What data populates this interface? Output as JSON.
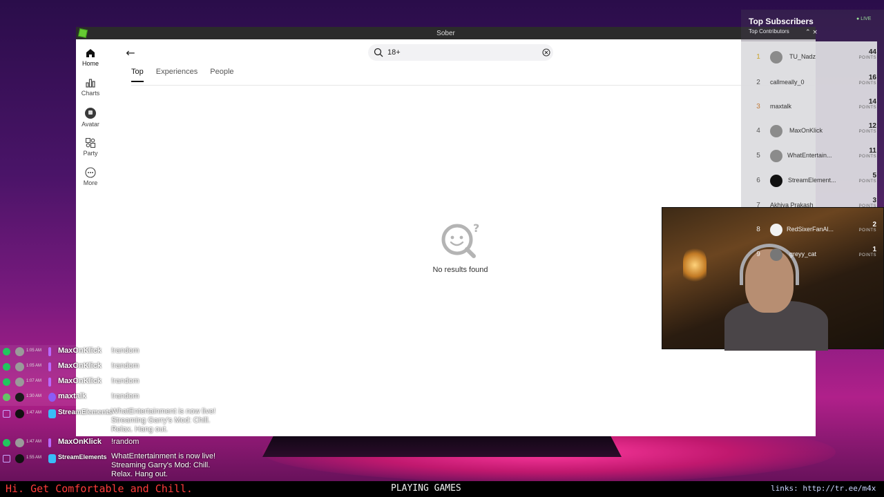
{
  "window": {
    "title": "Sober"
  },
  "sidebar": {
    "items": [
      {
        "label": "Home",
        "icon": "home-icon",
        "active": true
      },
      {
        "label": "Charts",
        "icon": "charts-icon"
      },
      {
        "label": "Avatar",
        "icon": "avatar-icon"
      },
      {
        "label": "Party",
        "icon": "party-icon"
      },
      {
        "label": "More",
        "icon": "more-icon"
      }
    ]
  },
  "search": {
    "value": "18+"
  },
  "tabs": [
    {
      "label": "Top",
      "active": true
    },
    {
      "label": "Experiences"
    },
    {
      "label": "People"
    }
  ],
  "empty_state": {
    "message": "No results found"
  },
  "leaderboard": {
    "title": "Top Subscribers",
    "subtitle": "Top Contributors",
    "live": "LIVE",
    "points_label": "POINTS",
    "rows": [
      {
        "rank": "1",
        "name": "TU_Nadz",
        "points": "44"
      },
      {
        "rank": "2",
        "name": "callmeally_0",
        "points": "16"
      },
      {
        "rank": "3",
        "name": "maxtalk",
        "points": "14"
      },
      {
        "rank": "4",
        "name": "MaxOnKlick",
        "points": "12"
      },
      {
        "rank": "5",
        "name": "WhatEntertain...",
        "points": "11"
      },
      {
        "rank": "6",
        "name": "StreamElement...",
        "points": "5"
      },
      {
        "rank": "7",
        "name": "Akhiya Prakash",
        "points": "3"
      },
      {
        "rank": "8",
        "name": "RedSixerFanAl...",
        "points": "2"
      },
      {
        "rank": "9",
        "name": "greyy_cat",
        "points": "1"
      }
    ]
  },
  "chat": [
    {
      "time": "1:05 AM",
      "user": "MaxOnKlick",
      "message": "!random"
    },
    {
      "time": "1:05 AM",
      "user": "MaxOnKlick",
      "message": "!random"
    },
    {
      "time": "1:07 AM",
      "user": "MaxOnKlick",
      "message": "!random"
    },
    {
      "time": "1:30 AM",
      "user": "maxtalk",
      "message": "!random"
    },
    {
      "time": "1:47 AM",
      "user": "StreamElements",
      "message": "WhatEntertainment is now live! Streaming Garry's Mod: Chill. Relax. Hang out."
    },
    {
      "time": "1:47 AM",
      "user": "MaxOnKlick",
      "message": "!random"
    },
    {
      "time": "1:55 AM",
      "user": "StreamElements",
      "message": "WhatEntertainment is now live! Streaming Garry's Mod: Chill. Relax. Hang out."
    }
  ],
  "ticker": {
    "left": "Hi. Get Comfortable and Chill.",
    "middle": "PLAYING GAMES",
    "right": "links: http://tr.ee/m4x"
  }
}
